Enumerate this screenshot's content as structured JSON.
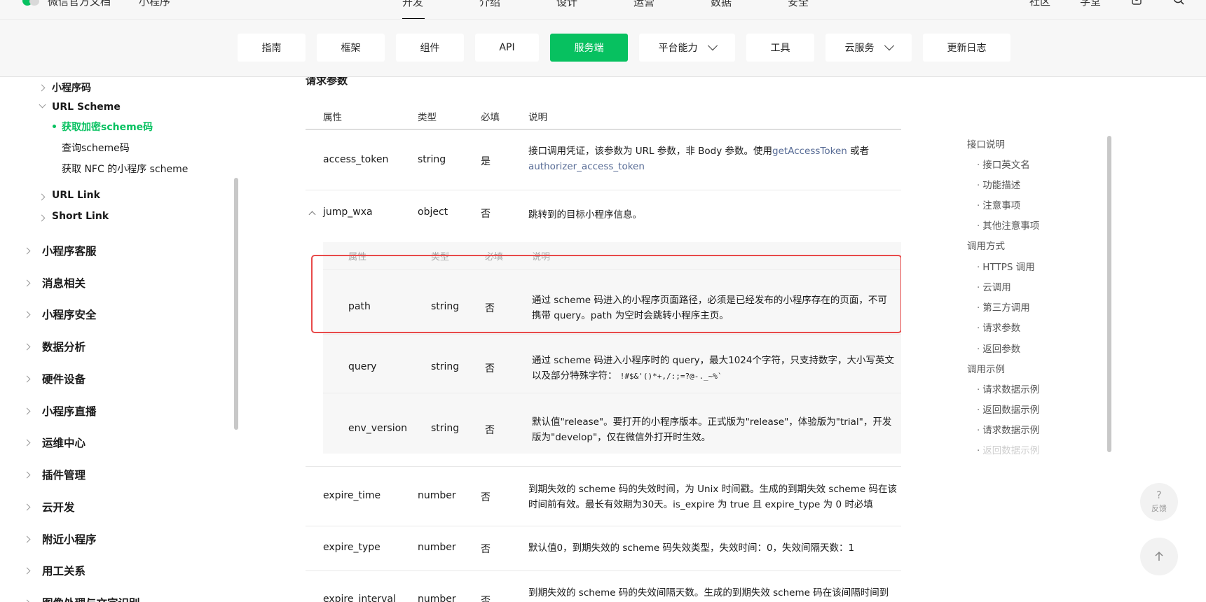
{
  "header": {
    "brand": "微信官方文档",
    "product": "小程序",
    "nav": [
      "开发",
      "介绍",
      "设计",
      "运营",
      "数据",
      "安全"
    ],
    "active_nav": "开发",
    "right_links": [
      "社区",
      "学堂"
    ]
  },
  "tabs": [
    {
      "label": "指南"
    },
    {
      "label": "框架"
    },
    {
      "label": "组件"
    },
    {
      "label": "API"
    },
    {
      "label": "服务端",
      "active": true
    },
    {
      "label": "平台能力",
      "dropdown": true
    },
    {
      "label": "工具"
    },
    {
      "label": "云服务",
      "dropdown": true
    },
    {
      "label": "更新日志"
    }
  ],
  "sidebar": {
    "sub_items": [
      {
        "label": "小程序码"
      },
      {
        "label": "URL Scheme"
      },
      {
        "label": "获取加密scheme码",
        "active": true
      },
      {
        "label": "查询scheme码"
      },
      {
        "label": "获取 NFC 的小程序 scheme"
      },
      {
        "label": "URL Link"
      },
      {
        "label": "Short Link"
      }
    ],
    "groups": [
      "小程序客服",
      "消息相关",
      "小程序安全",
      "数据分析",
      "硬件设备",
      "小程序直播",
      "运维中心",
      "插件管理",
      "云开发",
      "附近小程序",
      "用工关系",
      "图像处理与文字识别"
    ]
  },
  "main": {
    "section_title": "请求参数",
    "columns": [
      "属性",
      "类型",
      "必填",
      "说明"
    ],
    "rows": [
      {
        "name": "access_token",
        "type": "string",
        "required": "是",
        "desc_a": "接口调用凭证，该参数为 URL 参数，非 Body 参数。使用",
        "desc_link1": "getAccessToken",
        "desc_b": " 或者",
        "desc_link2": "authorizer_access_token"
      },
      {
        "name": "jump_wxa",
        "type": "object",
        "required": "否",
        "desc": "跳转到的目标小程序信息。"
      }
    ],
    "nested_columns": [
      "属性",
      "类型",
      "必填",
      "说明"
    ],
    "nested_rows": [
      {
        "name": "path",
        "type": "string",
        "required": "否",
        "desc1": "通过 scheme 码进入的小程序页面路径，必须是已经发布的小程序存在的页面，不可",
        "desc2": "携带 query。path 为空时会跳转小程序主页。"
      },
      {
        "name": "query",
        "type": "string",
        "required": "否",
        "desc1": "通过 scheme 码进入小程序时的 query，最大1024个字符，只支持数字，大小写英文",
        "desc2_a": "以及部分特殊字符：",
        "desc2_code": "!#$&'()*+,/:;=?@-._~%`"
      },
      {
        "name": "env_version",
        "type": "string",
        "required": "否",
        "desc1": "默认值\"release\"。要打开的小程序版本。正式版为\"release\"，体验版为\"trial\"，开发",
        "desc2": "版为\"develop\"，仅在微信外打开时生效。"
      }
    ],
    "rows_after": [
      {
        "name": "expire_time",
        "type": "number",
        "required": "否",
        "desc1": "到期失效的 scheme 码的失效时间，为 Unix 时间戳。生成的到期失效 scheme 码在该",
        "desc2": "时间前有效。最长有效期为30天。is_expire 为 true 且 expire_type 为 0 时必填"
      },
      {
        "name": "expire_type",
        "type": "number",
        "required": "否",
        "desc1": "默认值0，到期失效的 scheme 码失效类型，失效时间：0，失效间隔天数：1"
      },
      {
        "name": "expire_interval",
        "type": "number",
        "required": "否",
        "desc1": "到期失效的 scheme 码的失效间隔天数。生成的到期失效 scheme 码在该间隔时间到"
      }
    ]
  },
  "toc": [
    {
      "label": "接口说明",
      "level": 1
    },
    {
      "label": "接口英文名",
      "level": 2
    },
    {
      "label": "功能描述",
      "level": 2
    },
    {
      "label": "注意事项",
      "level": 2
    },
    {
      "label": "其他注意事项",
      "level": 2
    },
    {
      "label": "调用方式",
      "level": 1
    },
    {
      "label": "HTTPS 调用",
      "level": 2
    },
    {
      "label": "云调用",
      "level": 2
    },
    {
      "label": "第三方调用",
      "level": 2
    },
    {
      "label": "请求参数",
      "level": 2
    },
    {
      "label": "返回参数",
      "level": 2
    },
    {
      "label": "调用示例",
      "level": 1
    },
    {
      "label": "请求数据示例",
      "level": 2
    },
    {
      "label": "返回数据示例",
      "level": 2
    },
    {
      "label": "请求数据示例",
      "level": 2
    },
    {
      "label": "返回数据示例",
      "level": 2,
      "faded": true
    }
  ],
  "feedback": {
    "symbol": "?",
    "label": "反馈"
  },
  "icons": {
    "search": "search-icon",
    "user": "user-icon",
    "back_to_top": "arrow-up-icon"
  },
  "colors": {
    "brand_green": "#07c160",
    "link": "#576b95",
    "highlight_red": "#e84a4a"
  }
}
